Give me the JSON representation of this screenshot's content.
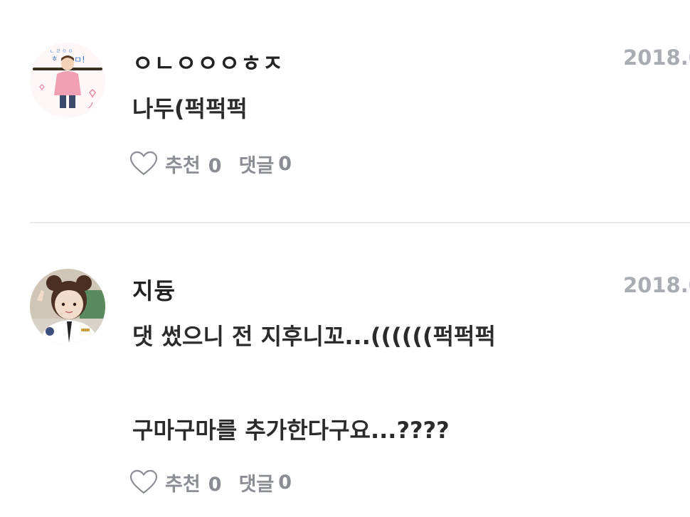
{
  "comments": [
    {
      "nickname": "ㅇㄴㅇㅇㅇㅎㅈ",
      "date": "2018.0",
      "lines": [
        "나두(퍽퍽퍽"
      ],
      "like_label": "추천",
      "like_count": "0",
      "reply_label": "댓글",
      "reply_count": "0",
      "avatar": "avatar-image"
    },
    {
      "nickname": "지듕",
      "date": "2018.0",
      "lines": [
        "댓 썼으니 전 지후니꼬...((((((퍽퍽퍽",
        "",
        "구마구마를 추가한다구요...????"
      ],
      "like_label": "추천",
      "like_count": "0",
      "reply_label": "댓글",
      "reply_count": "0",
      "avatar": "avatar-image"
    }
  ],
  "icons": {
    "like": "heart-outline-icon"
  },
  "colors": {
    "text": "#2b2b2b",
    "muted": "#8a8e94",
    "date": "#a9adb3",
    "divider": "#e9eaec"
  }
}
